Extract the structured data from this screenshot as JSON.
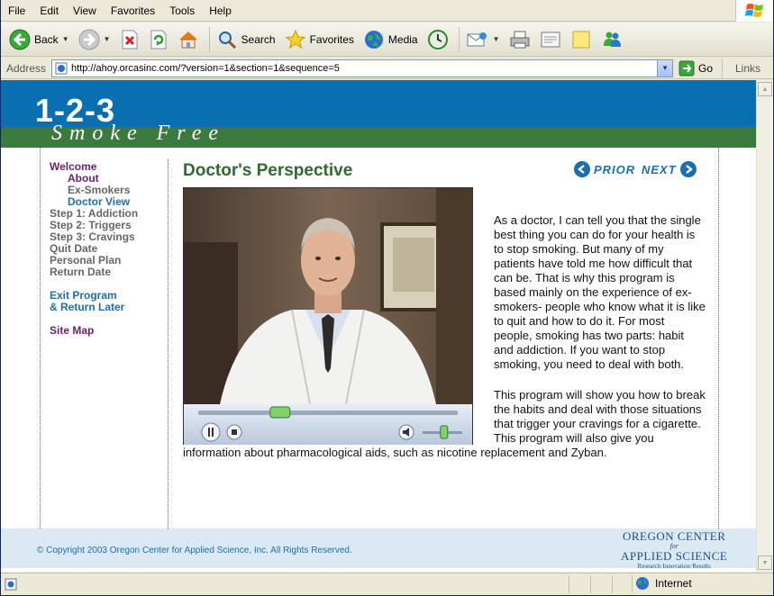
{
  "menu": [
    "File",
    "Edit",
    "View",
    "Favorites",
    "Tools",
    "Help"
  ],
  "toolbar": {
    "back": "Back",
    "search": "Search",
    "favorites": "Favorites",
    "media": "Media"
  },
  "address": {
    "label": "Address",
    "url": "http://ahoy.orcasinc.com/?version=1&section=1&sequence=5",
    "go": "Go",
    "links": "Links"
  },
  "site": {
    "logo_numbers": "1-2-3",
    "logo_words": "Smoke Free"
  },
  "nav": {
    "welcome": "Welcome",
    "about": "About",
    "ex_smokers": "Ex-Smokers",
    "doctor_view": "Doctor View",
    "step1": "Step 1: Addiction",
    "step2": "Step 2: Triggers",
    "step3": "Step 3: Cravings",
    "quit_date": "Quit Date",
    "personal_plan": "Personal Plan",
    "return_date": "Return Date",
    "exit1": "Exit Program",
    "exit2": "& Return Later",
    "site_map": "Site Map"
  },
  "page": {
    "title": "Doctor's Perspective",
    "prior": "PRIOR",
    "next": "NEXT",
    "para1": "As a doctor, I can tell you that the single best thing you can do for your health is to stop smoking. But many of my patients have told me how difficult that can be. That is why this program is based mainly on the experience of ex-smokers- people who know what it is like to quit and how to do it. For most people, smoking has two parts: habit and addiction. If you want to stop smoking, you need to deal with both.",
    "para2": "This program will show you how to break the habits  and deal with those situations that trigger your cravings for a cigarette. This program will also give you information about pharmacological aids, such as nicotine replacement and Zyban."
  },
  "video": {
    "progress": 0.3,
    "volume": 0.55
  },
  "footer": {
    "copyright": "© Copyright 2003 Oregon Center for Applied Science, Inc. All Rights Reserved.",
    "org_line1": "OREGON CENTER",
    "org_for": "for",
    "org_line2": "APPLIED SCIENCE",
    "org_tagline": "Research·Innovation·Results"
  },
  "status": {
    "zone": "Internet"
  },
  "colors": {
    "banner_blue": "#0a6fb0",
    "banner_green": "#3a7a3c",
    "title_green": "#2f6a2f",
    "nav_purple": "#6b1f6b",
    "link_blue": "#1c6eb0"
  }
}
